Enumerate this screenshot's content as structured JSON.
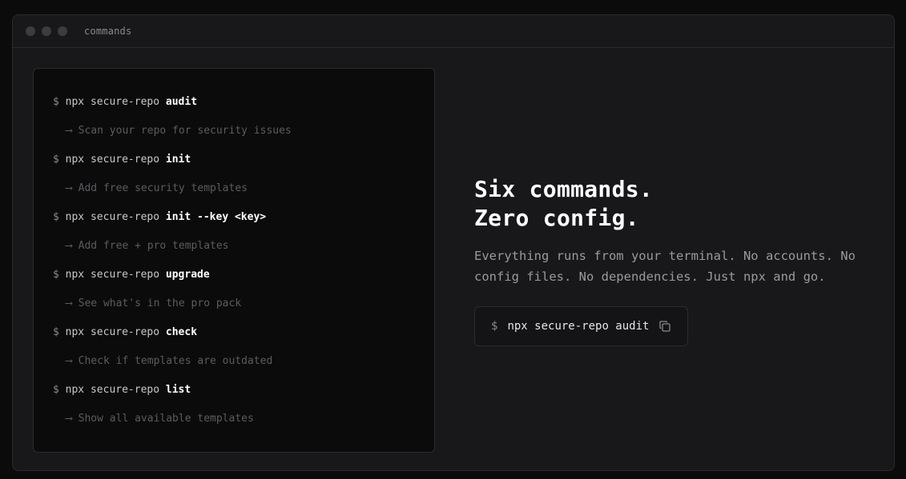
{
  "window": {
    "title": "commands"
  },
  "terminal": {
    "prompt": "$",
    "commands": [
      {
        "base": "npx secure-repo",
        "sub": "audit",
        "desc": "Scan your repo for security issues"
      },
      {
        "base": "npx secure-repo",
        "sub": "init",
        "desc": "Add free security templates"
      },
      {
        "base": "npx secure-repo",
        "sub": "init --key <key>",
        "desc": "Add free + pro templates"
      },
      {
        "base": "npx secure-repo",
        "sub": "upgrade",
        "desc": "See what's in the pro pack"
      },
      {
        "base": "npx secure-repo",
        "sub": "check",
        "desc": "Check if templates are outdated"
      },
      {
        "base": "npx secure-repo",
        "sub": "list",
        "desc": "Show all available templates"
      }
    ],
    "arrow": "⟶"
  },
  "hero": {
    "headline_line1": "Six commands.",
    "headline_line2": "Zero config.",
    "subtext": "Everything runs from your terminal. No accounts. No config files. No dependencies. Just npx and go.",
    "command_prompt": "$",
    "command_text": "npx secure-repo audit",
    "copy_icon": "copy-icon"
  }
}
